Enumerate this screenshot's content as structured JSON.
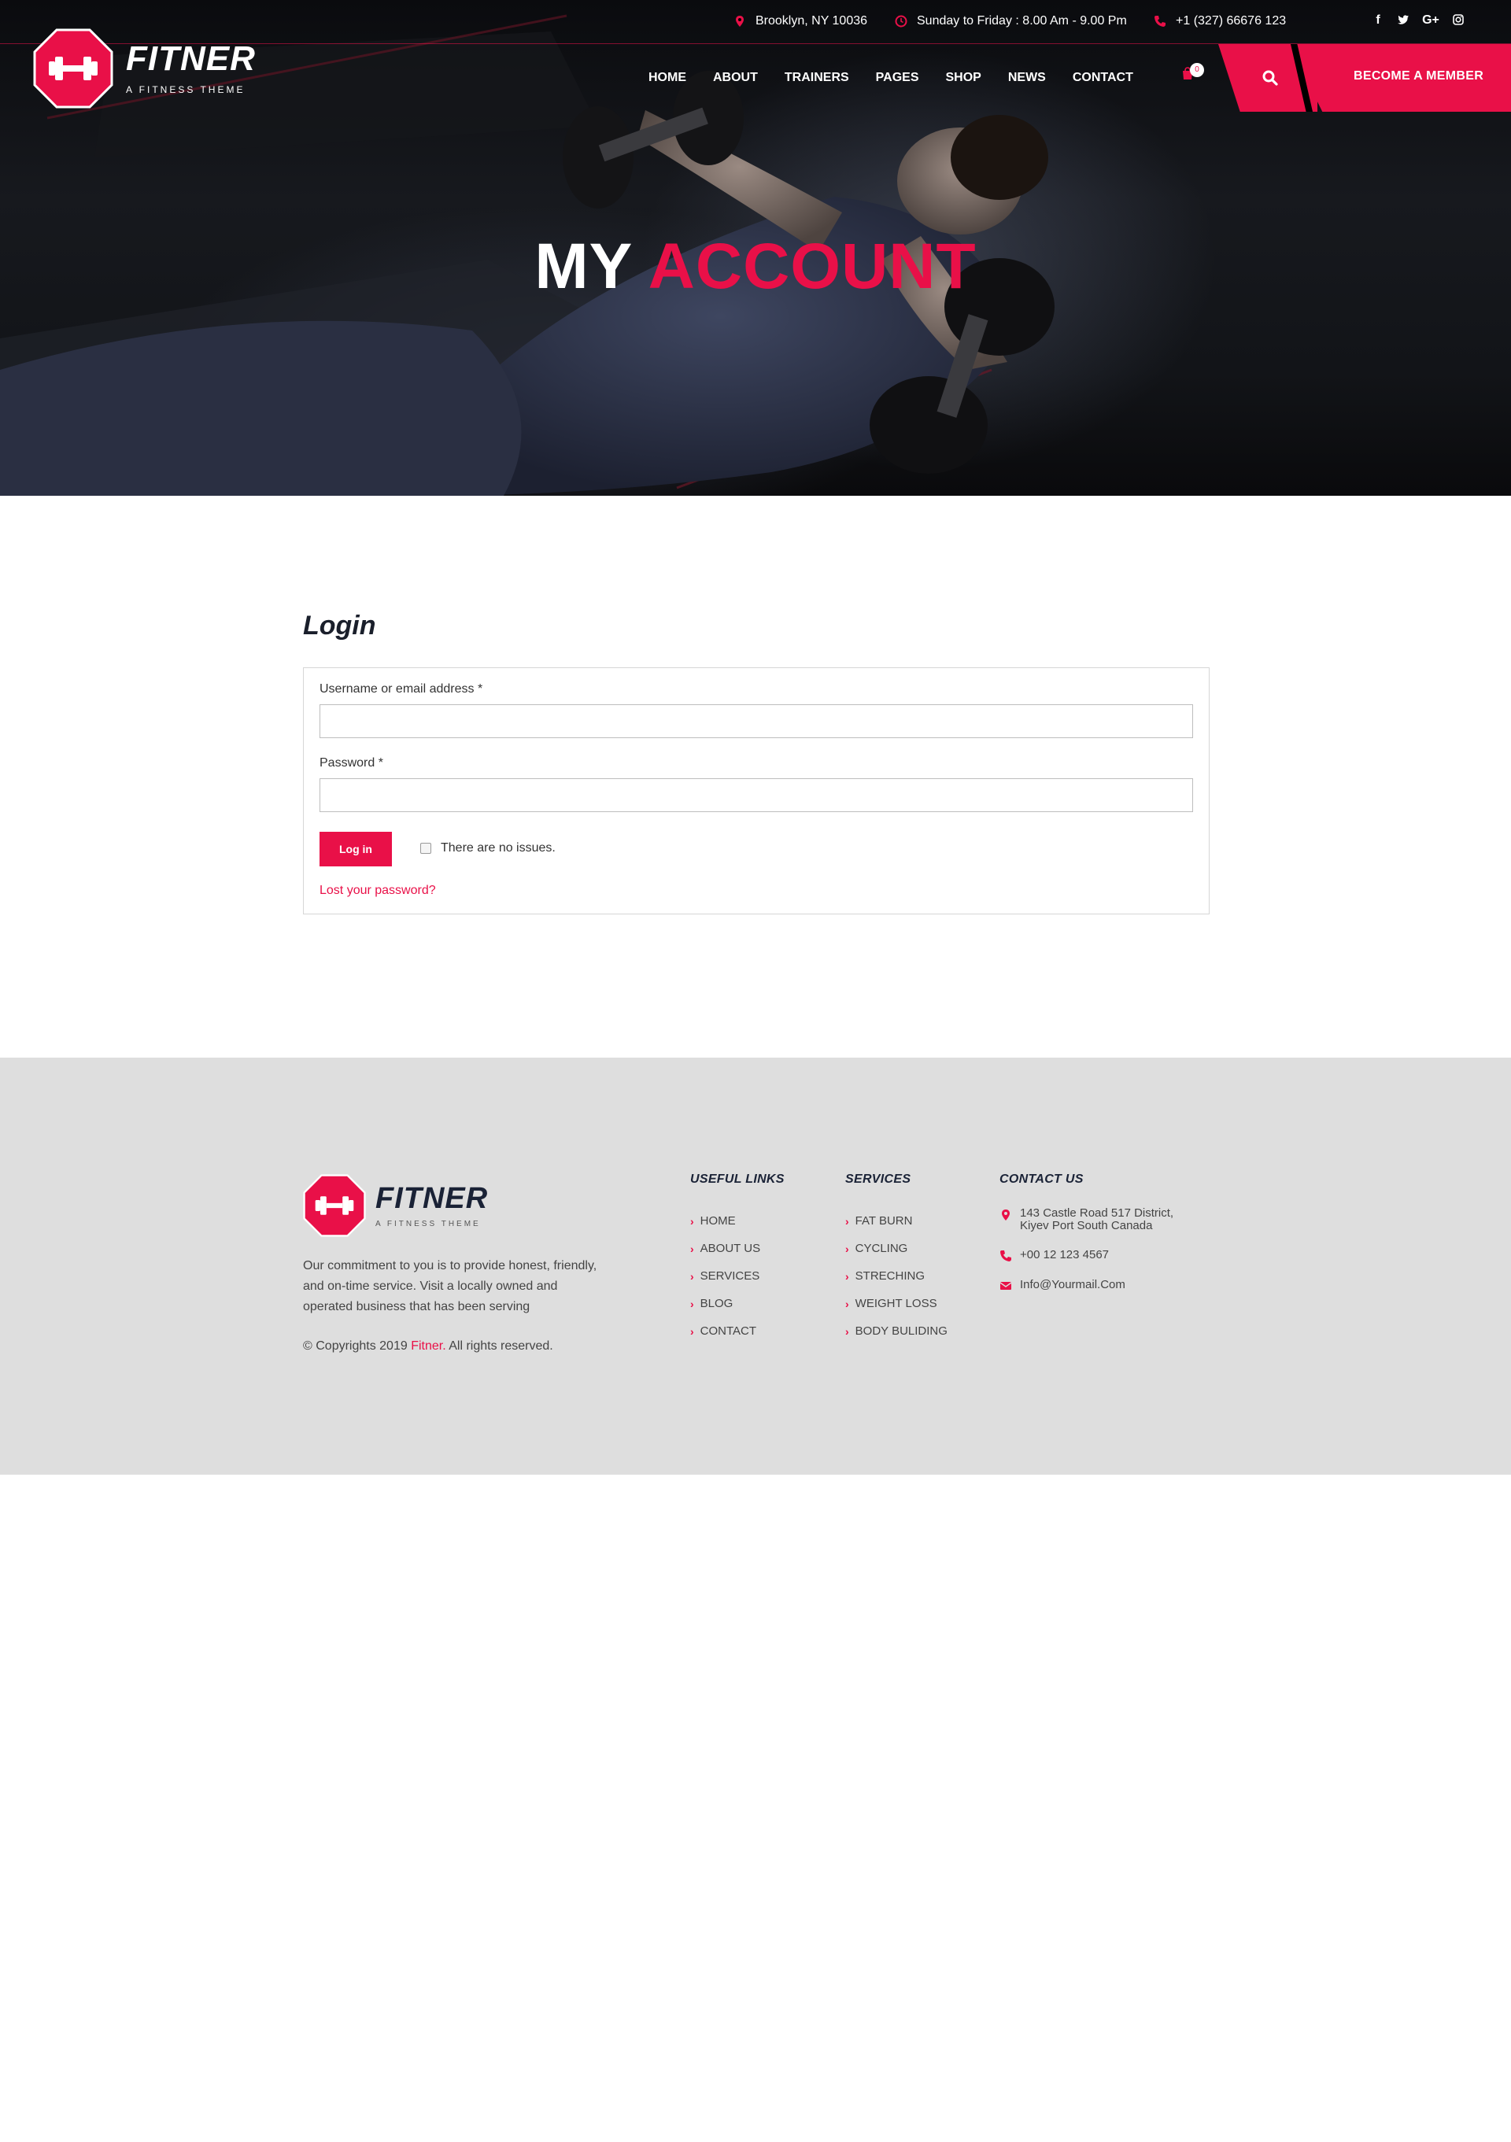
{
  "topbar": {
    "location": "Brooklyn, NY 10036",
    "hours": "Sunday to Friday : 8.00 Am - 9.00 Pm",
    "phone": "+1 (327) 66676 123",
    "socials": [
      "f",
      "t",
      "G+",
      "ig"
    ]
  },
  "brand": {
    "name": "FITNER",
    "tagline": "A FITNESS THEME"
  },
  "nav": {
    "items": [
      "HOME",
      "ABOUT",
      "TRAINERS",
      "PAGES",
      "SHOP",
      "NEWS",
      "CONTACT"
    ],
    "cart_count": "0",
    "member_label": "BECOME A MEMBER"
  },
  "hero": {
    "title_white": "MY",
    "title_red": "ACCOUNT"
  },
  "login": {
    "heading": "Login",
    "username_label": "Username or email address *",
    "username_value": "",
    "password_label": "Password *",
    "password_value": "",
    "submit_label": "Log in",
    "checkbox_label": "There are no issues.",
    "lost_password": "Lost your password?"
  },
  "footer": {
    "brand_name": "FITNER",
    "brand_tagline": "A FITNESS THEME",
    "description": "Our commitment to you is to provide honest, friendly, and on-time service. Visit a locally owned and operated business that has been serving",
    "copyright_prefix": "© Copyrights 2019",
    "copyright_brand": "Fitner.",
    "copyright_suffix": "All rights reserved.",
    "useful_links": {
      "title": "USEFUL LINKS",
      "items": [
        "HOME",
        "ABOUT US",
        "SERVICES",
        "BLOG",
        "CONTACT"
      ]
    },
    "services": {
      "title": "SERVICES",
      "items": [
        "FAT BURN",
        "CYCLING",
        "STRECHING",
        "WEIGHT LOSS",
        "BODY BULIDING"
      ]
    },
    "contact": {
      "title": "CONTACT US",
      "address_line1": "143 Castle Road 517 District,",
      "address_line2": "Kiyev Port South Canada",
      "phone": "+00 12 123 4567",
      "email": "Info@Yourmail.Com"
    }
  },
  "colors": {
    "accent": "#e91048",
    "dark": "#1a2236",
    "footer_bg": "#dedede"
  }
}
